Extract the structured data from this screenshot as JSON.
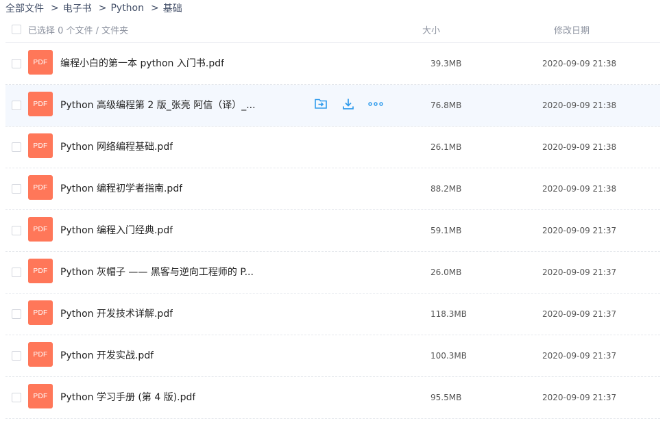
{
  "breadcrumb": {
    "items": [
      "全部文件",
      "电子书",
      "Python",
      "基础"
    ],
    "separator": ">"
  },
  "header": {
    "selection_text": "已选择 0 个文件 / 文件夹",
    "col_size": "大小",
    "col_date": "修改日期"
  },
  "colors": {
    "pdf_icon": "#ff7759",
    "action_icon": "#2f9bec",
    "hover_row": "#f4f8fe"
  },
  "file_type_label": "PDF",
  "files": [
    {
      "name": "编程小白的第一本 python 入门书.pdf",
      "size": "39.3MB",
      "date": "2020-09-09 21:38"
    },
    {
      "name": "Python 高级编程第 2 版_张亮 阿信（译）_...",
      "size": "76.8MB",
      "date": "2020-09-09 21:38",
      "hover": true,
      "actions": [
        "move-to-folder-icon",
        "download-icon",
        "more-icon"
      ]
    },
    {
      "name": "Python 网络编程基础.pdf",
      "size": "26.1MB",
      "date": "2020-09-09 21:38"
    },
    {
      "name": "Python 编程初学者指南.pdf",
      "size": "88.2MB",
      "date": "2020-09-09 21:38"
    },
    {
      "name": "Python 编程入门经典.pdf",
      "size": "59.1MB",
      "date": "2020-09-09 21:37"
    },
    {
      "name": "Python 灰帽子 —— 黑客与逆向工程师的 P...",
      "size": "26.0MB",
      "date": "2020-09-09 21:37"
    },
    {
      "name": "Python 开发技术详解.pdf",
      "size": "118.3MB",
      "date": "2020-09-09 21:37"
    },
    {
      "name": "Python 开发实战.pdf",
      "size": "100.3MB",
      "date": "2020-09-09 21:37"
    },
    {
      "name": "Python 学习手册 (第 4 版).pdf",
      "size": "95.5MB",
      "date": "2020-09-09 21:37"
    }
  ]
}
